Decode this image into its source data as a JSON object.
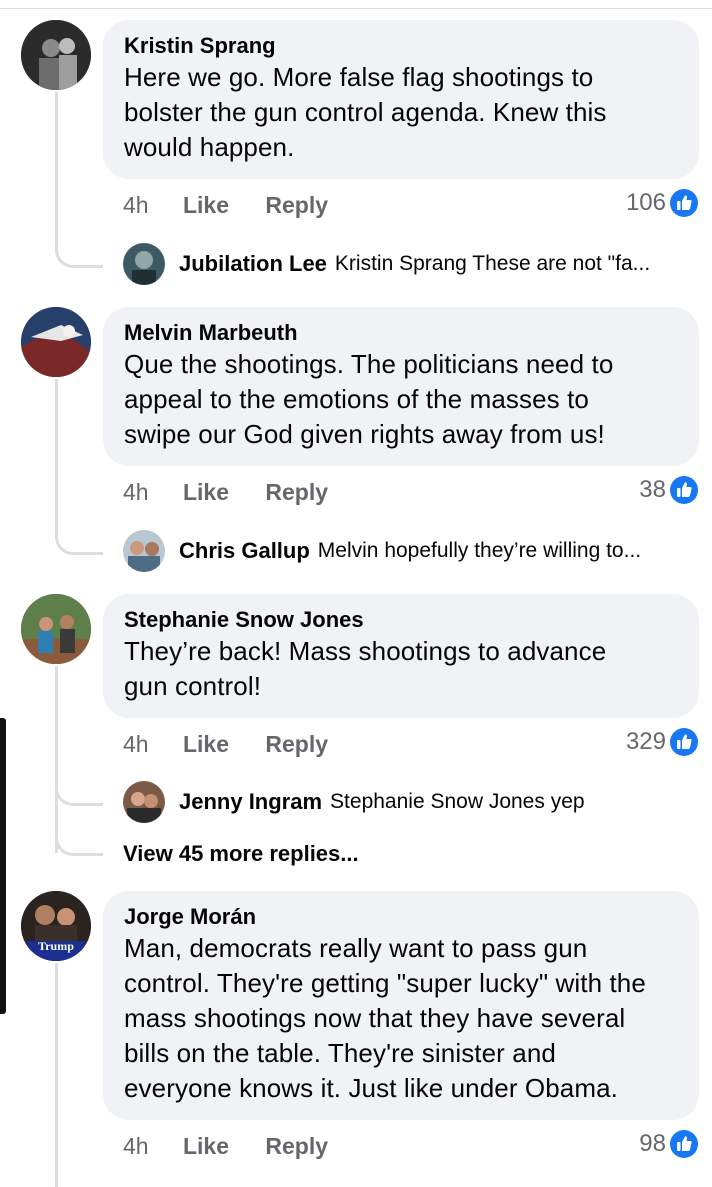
{
  "comments": [
    {
      "author": "Kristin Sprang",
      "lines": [
        "Here we go. More false flag shootings to",
        "bolster the gun control agenda. Knew this",
        "would happen."
      ],
      "time": "4h",
      "like": "Like",
      "reply": "Reply",
      "reactions": "106",
      "reply_preview": {
        "author": "Jubilation Lee",
        "text": "Kristin Sprang These are not \"fa..."
      }
    },
    {
      "author": "Melvin Marbeuth",
      "lines": [
        "Que the shootings.  The politicians need to",
        "appeal to the emotions of the masses to",
        "swipe our God given rights away from us!"
      ],
      "time": "4h",
      "like": "Like",
      "reply": "Reply",
      "reactions": "38",
      "reply_preview": {
        "author": "Chris Gallup",
        "text": "Melvin hopefully they’re willing to..."
      }
    },
    {
      "author": "Stephanie Snow Jones",
      "lines": [
        "They’re back! Mass shootings to advance",
        "gun control!"
      ],
      "time": "4h",
      "like": "Like",
      "reply": "Reply",
      "reactions": "329",
      "reply_preview": {
        "author": "Jenny Ingram",
        "text": "Stephanie Snow Jones yep"
      },
      "more_replies": "View 45 more replies..."
    },
    {
      "author": "Jorge Morán",
      "lines": [
        "Man, democrats really want to pass gun",
        "control. They're getting \"super lucky\" with the",
        "mass shootings now that they have several",
        "bills on the table. They're sinister and",
        "everyone knows it. Just like under Obama."
      ],
      "avatar_badge": "Trump",
      "time": "4h",
      "like": "Like",
      "reply": "Reply",
      "reactions": "98"
    }
  ],
  "colors": {
    "bubble": "#f0f2f5",
    "meta": "#65676b",
    "like_blue": "#1877f2",
    "connector": "#dadde1"
  },
  "icons": {
    "reaction": "like-thumb-icon"
  }
}
